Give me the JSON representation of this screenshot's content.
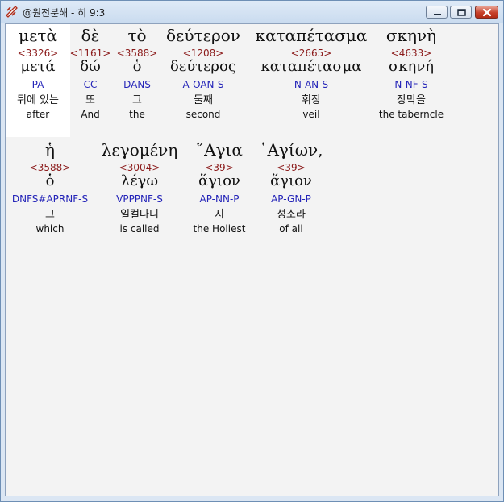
{
  "window": {
    "title": "@원전분해 - 히 9:3",
    "controls": {
      "minimize_icon": "minimize-icon",
      "maximize_icon": "maximize-icon",
      "close_icon": "close-icon",
      "close_color": "#c7402a"
    }
  },
  "colors": {
    "strong": "#8b1a1a",
    "parse": "#2323b8",
    "text": "#111111",
    "highlight": "#ffffff"
  },
  "words": [
    {
      "greek": "μετὰ",
      "strong": "<3326>",
      "lexeme": "μετά",
      "parse": "PA",
      "korean": "뒤에 있는",
      "english": "after",
      "highlighted": true
    },
    {
      "greek": "δὲ",
      "strong": "<1161>",
      "lexeme": "δώ",
      "parse": "CC",
      "korean": "또",
      "english": "And"
    },
    {
      "greek": "τὸ",
      "strong": "<3588>",
      "lexeme": "ὁ",
      "parse": "DANS",
      "korean": "그",
      "english": "the"
    },
    {
      "greek": "δεύτερον",
      "strong": "<1208>",
      "lexeme": "δεύτερος",
      "parse": "A-OAN-S",
      "korean": "둘째",
      "english": "second"
    },
    {
      "greek": "καταπέτασμα",
      "strong": "<2665>",
      "lexeme": "καταπέτασμα",
      "parse": "N-AN-S",
      "korean": "휘장",
      "english": "veil"
    },
    {
      "greek": "σκηνὴ",
      "strong": "<4633>",
      "lexeme": "σκηνή",
      "parse": "N-NF-S",
      "korean": "장막을",
      "english": "the taberncle"
    },
    {
      "greek": "ἡ",
      "strong": "<3588>",
      "lexeme": "ὁ",
      "parse": "DNFS#APRNF-S",
      "korean": "그",
      "english": "which"
    },
    {
      "greek": "λεγομένη",
      "strong": "<3004>",
      "lexeme": "λέγω",
      "parse": "VPPPNF-S",
      "korean": "일컬나니",
      "english": "is called"
    },
    {
      "greek": "῞Αγια",
      "strong": "<39>",
      "lexeme": "ἅγιον",
      "parse": "AP-NN-P",
      "korean": "지",
      "english": "the Holiest"
    },
    {
      "greek": "῾Αγίων,",
      "strong": "<39>",
      "lexeme": "ἅγιον",
      "parse": "AP-GN-P",
      "korean": "성소라",
      "english": "of all"
    }
  ]
}
